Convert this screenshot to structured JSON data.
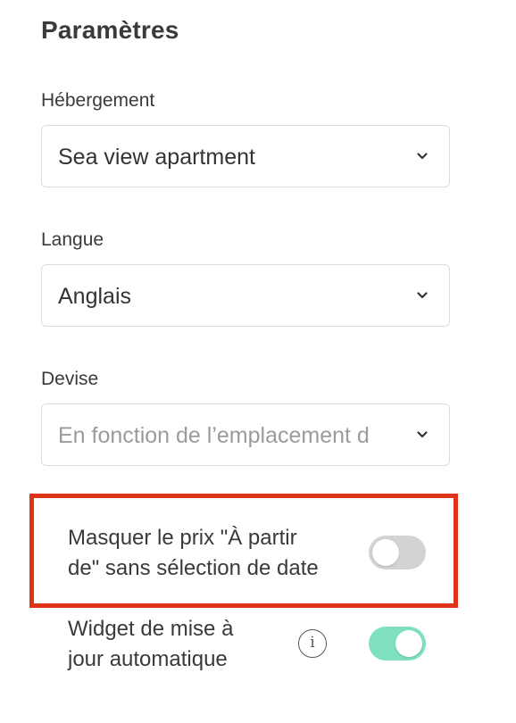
{
  "settings": {
    "title": "Paramètres",
    "accommodation": {
      "label": "Hébergement",
      "value": "Sea view apartment"
    },
    "language": {
      "label": "Langue",
      "value": "Anglais"
    },
    "currency": {
      "label": "Devise",
      "placeholder": "En fonction de l’emplacement d"
    },
    "hide_price": {
      "label_line1": "Masquer le prix \"À partir",
      "label_line2": "de\" sans sélection de date",
      "enabled": false
    },
    "auto_update_widget": {
      "label_line1": "Widget de mise à",
      "label_line2": "jour automatique",
      "info_icon": "i",
      "enabled": true
    }
  },
  "colors": {
    "highlight_border": "#e03416",
    "toggle_on": "#7ee0bd",
    "toggle_off": "#d3d3d3"
  },
  "icons": [
    "chevron-down-icon",
    "info-icon"
  ]
}
